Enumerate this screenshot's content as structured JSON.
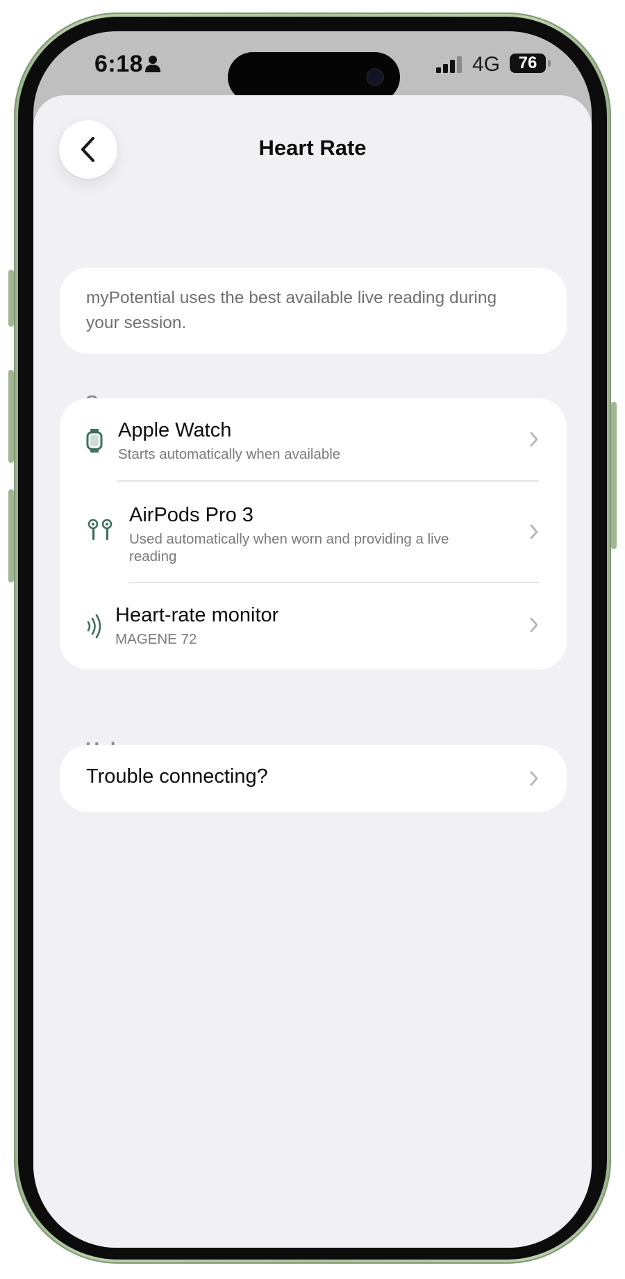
{
  "status_bar": {
    "time": "6:18",
    "network": "4G",
    "battery": "76",
    "icons": [
      "person-icon",
      "cellular-signal-icon"
    ]
  },
  "header": {
    "title": "Heart Rate",
    "back_icon": "chevron-left-icon"
  },
  "info": {
    "text": "myPotential uses the best available live reading during your session."
  },
  "sources": {
    "header": "Sources",
    "items": [
      {
        "title": "Apple Watch",
        "subtitle": "Starts automatically when available",
        "icon": "apple-watch-icon"
      },
      {
        "title": "AirPods Pro 3",
        "subtitle": "Used automatically when worn and providing a live reading",
        "icon": "airpods-icon"
      },
      {
        "title": "Heart-rate monitor",
        "subtitle": "MAGENE 72",
        "icon": "wireless-signal-icon"
      }
    ]
  },
  "help": {
    "header": "Help",
    "items": [
      {
        "title": "Trouble connecting?"
      }
    ]
  },
  "colors": {
    "accent": "#3f6f60",
    "background": "#f0f0f5",
    "card": "#ffffff",
    "secondary_text": "#7a7a7f",
    "frame": "#aec49f"
  }
}
